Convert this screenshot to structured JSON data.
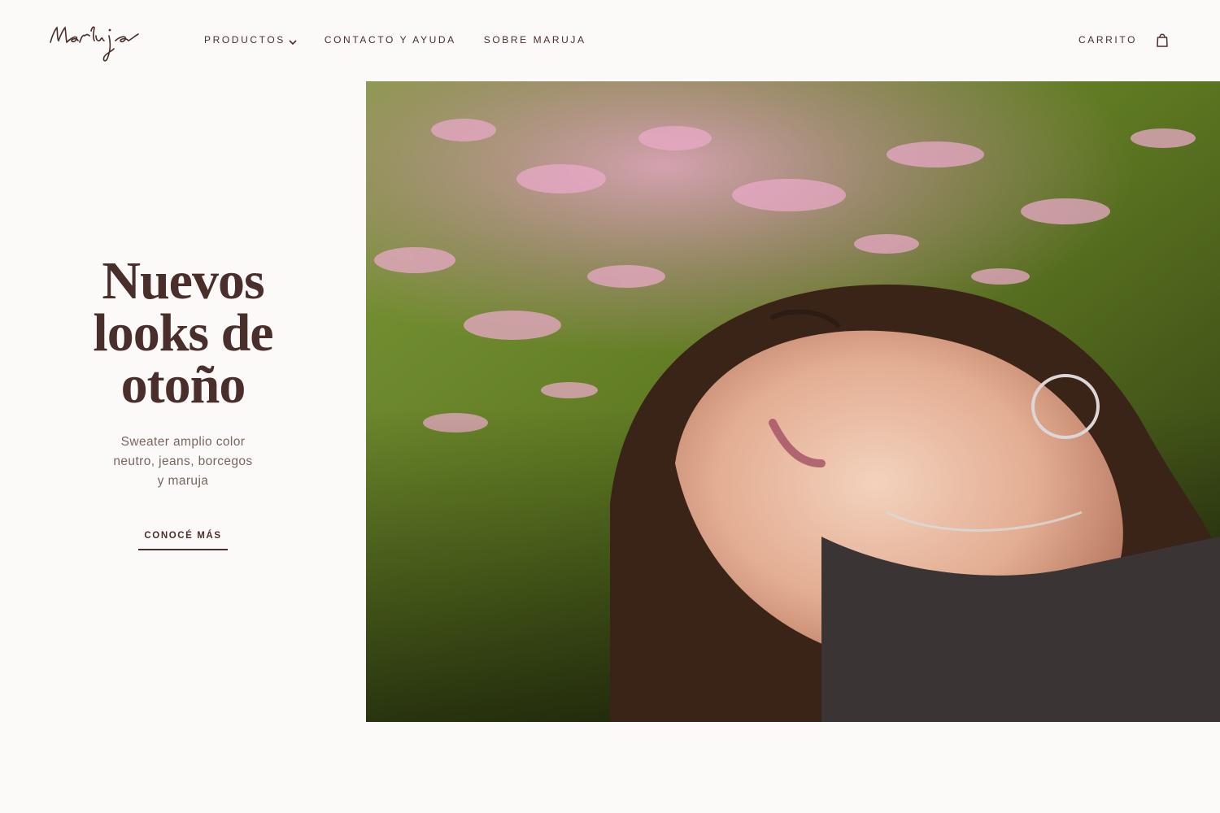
{
  "brand": {
    "logo_text": "Maruja"
  },
  "nav": {
    "items": [
      {
        "label": "PRODUCTOS",
        "has_dropdown": true
      },
      {
        "label": "CONTACTO Y AYUDA"
      },
      {
        "label": "SOBRE MARUJA"
      }
    ]
  },
  "cart": {
    "label": "CARRITO",
    "icon": "shopping-bag-icon"
  },
  "hero": {
    "headline": [
      "Nuevos",
      "looks de",
      "otoño"
    ],
    "subtitle": [
      "Sweater amplio color",
      "neutro, jeans, borcegos",
      "y maruja"
    ],
    "cta_label": "CONOCÉ MÁS",
    "image": "woman lying on grass with pink flowers"
  },
  "colors": {
    "text": "#4a2e2b",
    "muted": "#7a6560",
    "background": "#fbfaf8"
  }
}
